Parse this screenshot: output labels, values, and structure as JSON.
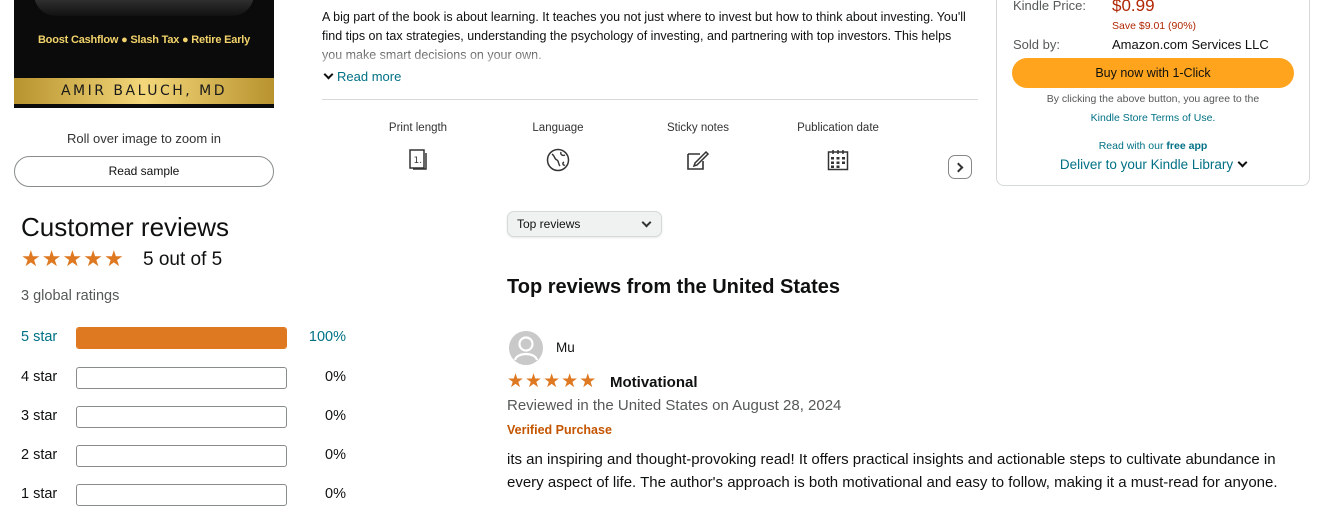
{
  "cover": {
    "tagline": "Boost Cashflow ● Slash Tax ● Retire Early",
    "author": "AMIR BALUCH, MD"
  },
  "media": {
    "zoom_hint": "Roll over image to zoom in",
    "read_sample": "Read sample"
  },
  "description": {
    "text": "A big part of the book is about learning. It teaches you not just where to invest but how to think about investing. You'll find tips on tax strategies, understanding the psychology of investing, and partnering with top investors. This helps you make smart decisions on your own.",
    "read_more": "Read more"
  },
  "attributes": [
    {
      "label": "Print length",
      "icon": "book-pages-icon"
    },
    {
      "label": "Language",
      "icon": "globe-icon"
    },
    {
      "label": "Sticky notes",
      "icon": "sticky-note-icon"
    },
    {
      "label": "Publication date",
      "icon": "calendar-icon"
    }
  ],
  "buybox": {
    "kindle_price_label": "Kindle Price:",
    "kindle_price": "$0.99",
    "savings": "Save $9.01 (90%)",
    "sold_by_label": "Sold by:",
    "sold_by": "Amazon.com Services LLC",
    "buy_button": "Buy now with 1-Click",
    "agree_text": "By clicking the above button, you agree to the",
    "store_terms": "Kindle Store Terms of Use.",
    "read_with": "Read with our",
    "free_app": "free app",
    "deliver": "Deliver to your Kindle Library"
  },
  "customer_reviews": {
    "title": "Customer reviews",
    "average": "5 out of 5",
    "rating_value": 5,
    "global_ratings": "3 global ratings",
    "histogram": [
      {
        "label": "5 star",
        "percent": "100%",
        "fraction": 1.0
      },
      {
        "label": "4 star",
        "percent": "0%",
        "fraction": 0
      },
      {
        "label": "3 star",
        "percent": "0%",
        "fraction": 0
      },
      {
        "label": "2 star",
        "percent": "0%",
        "fraction": 0
      },
      {
        "label": "1 star",
        "percent": "0%",
        "fraction": 0
      }
    ]
  },
  "reviews_panel": {
    "sort_selected": "Top reviews",
    "heading": "Top reviews from the United States"
  },
  "review": {
    "reviewer": "Mu",
    "rating": 5,
    "title": "Motivational",
    "date": "Reviewed in the United States on August 28, 2024",
    "verified": "Verified Purchase",
    "body": "its an inspiring and thought-provoking read! It offers practical insights and actionable steps to cultivate abundance in every aspect of life. The author's approach is both motivational and easy to follow, making it a must-read for anyone."
  },
  "colors": {
    "star": "#de7921",
    "link": "#007185",
    "price": "#b12704",
    "buy_button": "#ffa41c",
    "verified": "#c45500"
  }
}
